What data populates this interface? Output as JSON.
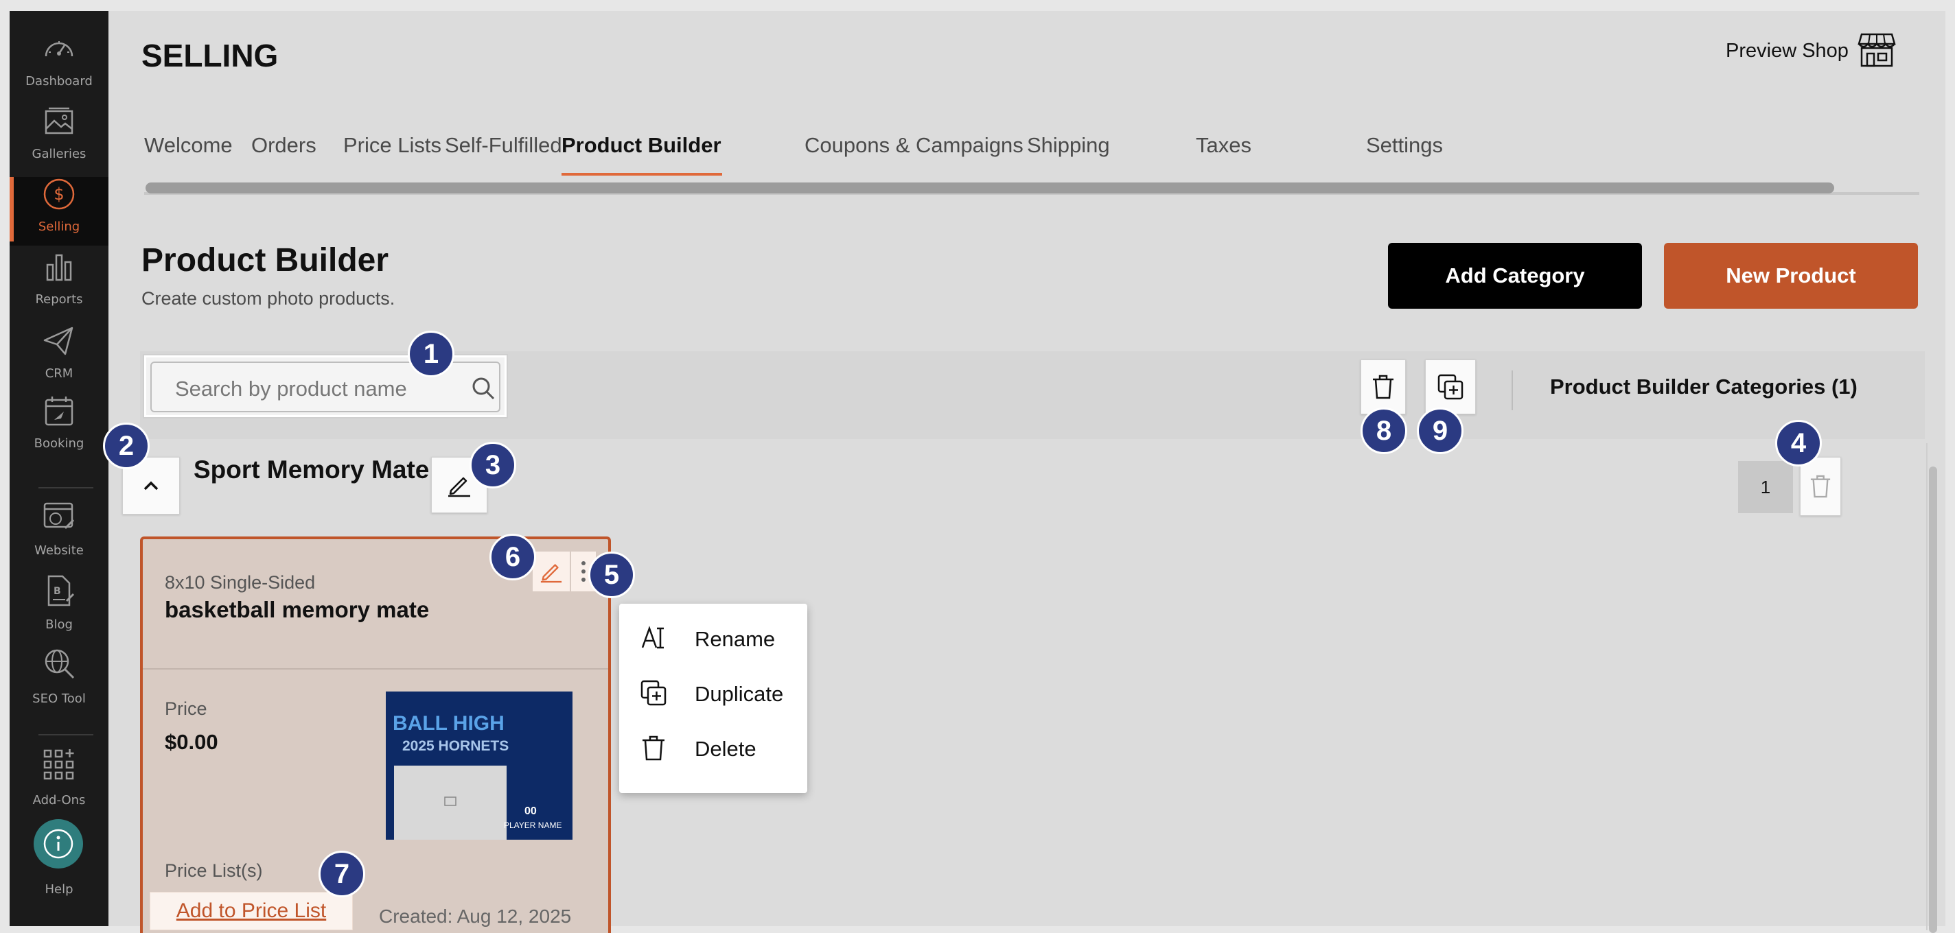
{
  "sidebar": {
    "items": [
      {
        "label": "Dashboard",
        "icon": "dashboard-gauge-icon"
      },
      {
        "label": "Galleries",
        "icon": "galleries-image-icon"
      },
      {
        "label": "Selling",
        "icon": "selling-dollar-icon",
        "active": true
      },
      {
        "label": "Reports",
        "icon": "reports-bar-chart-icon"
      },
      {
        "label": "CRM",
        "icon": "crm-paper-plane-icon"
      },
      {
        "label": "Booking",
        "icon": "booking-calendar-icon"
      },
      {
        "label": "Website",
        "icon": "website-globe-icon"
      },
      {
        "label": "Blog",
        "icon": "blog-document-icon"
      },
      {
        "label": "SEO Tool",
        "icon": "seo-globe-search-icon"
      },
      {
        "label": "Add-Ons",
        "icon": "add-ons-grid-icon"
      },
      {
        "label": "Help",
        "icon": "help-info-icon"
      }
    ]
  },
  "header": {
    "title": "SELLING",
    "preview_shop": "Preview Shop"
  },
  "tabs": [
    {
      "label": "Welcome"
    },
    {
      "label": "Orders"
    },
    {
      "label": "Price Lists"
    },
    {
      "label": "Self-Fulfilled"
    },
    {
      "label": "Product Builder",
      "active": true
    },
    {
      "label": "Coupons & Campaigns"
    },
    {
      "label": "Shipping"
    },
    {
      "label": "Taxes"
    },
    {
      "label": "Settings"
    }
  ],
  "page": {
    "title": "Product Builder",
    "subtitle": "Create custom photo products.",
    "add_category": "Add Category",
    "new_product": "New Product"
  },
  "search": {
    "placeholder": "Search by product name"
  },
  "categories_header": "Product Builder Categories (1)",
  "category": {
    "name": "Sport Memory Mate",
    "count": "1"
  },
  "product_card": {
    "subtitle": "8x10 Single-Sided",
    "title": "basketball memory mate",
    "price_label": "Price",
    "price_value": "$0.00",
    "price_lists_label": "Price List(s)",
    "add_to_price_list": "Add to Price List",
    "created": "Created: Aug 12, 2025",
    "thumbnail": {
      "line1": "BALL HIGH",
      "line2": "2025 HORNETS",
      "number": "00",
      "player": "PLAYER NAME"
    }
  },
  "context_menu": [
    {
      "label": "Rename",
      "icon": "rename-text-cursor-icon"
    },
    {
      "label": "Duplicate",
      "icon": "duplicate-icon"
    },
    {
      "label": "Delete",
      "icon": "trash-icon"
    }
  ],
  "badges": [
    "1",
    "2",
    "3",
    "4",
    "5",
    "6",
    "7",
    "8",
    "9"
  ],
  "colors": {
    "accent": "#c0552a",
    "sidebar_bg": "#1b1b1b",
    "badge": "#2b3a82"
  }
}
